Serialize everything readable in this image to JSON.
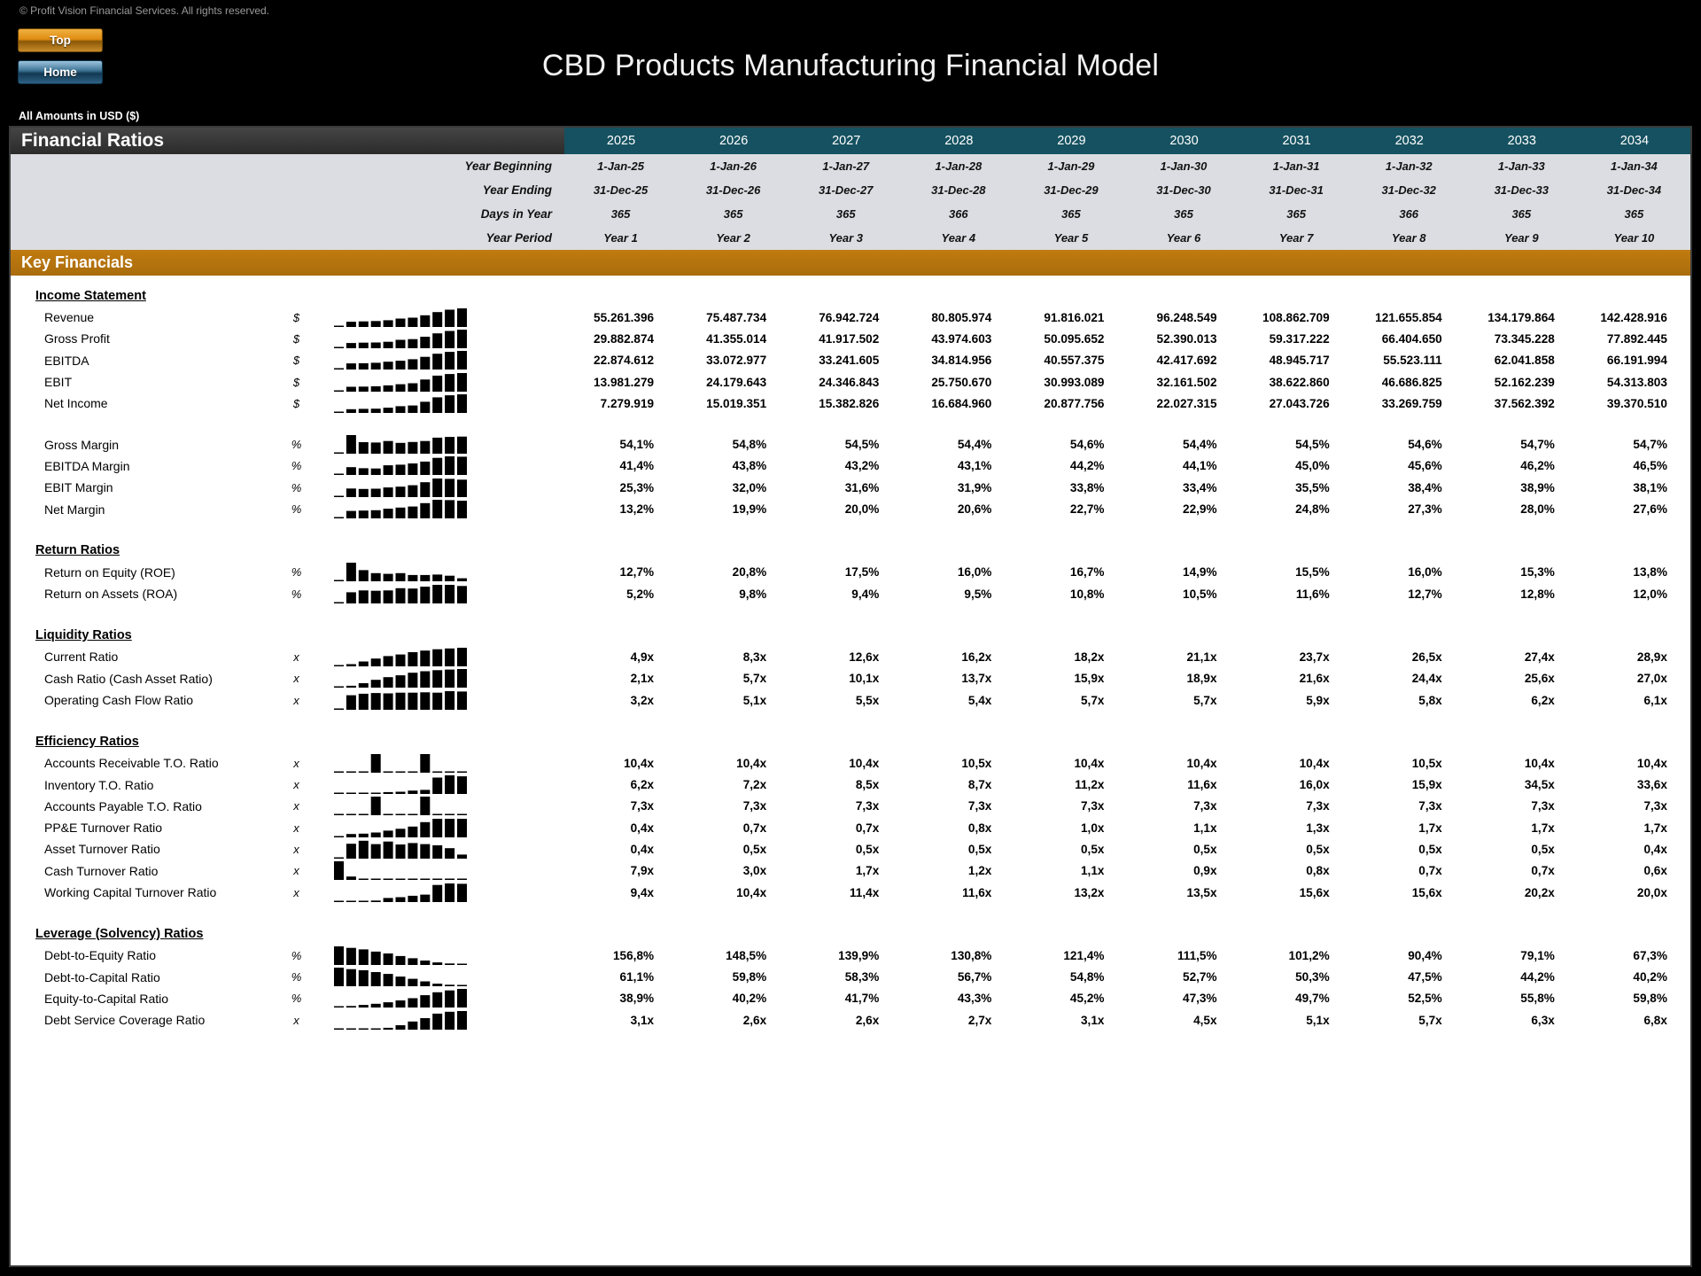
{
  "copyright": "© Profit Vision Financial Services. All rights reserved.",
  "nav": {
    "top_label": "Top",
    "home_label": "Home"
  },
  "title": "CBD Products Manufacturing Financial Model",
  "amounts_label": "All Amounts in  USD ($)",
  "section_title": "Financial Ratios",
  "key_financials_label": "Key Financials",
  "years": [
    "2025",
    "2026",
    "2027",
    "2028",
    "2029",
    "2030",
    "2031",
    "2032",
    "2033",
    "2034"
  ],
  "band": [
    {
      "label": "Year Beginning",
      "values": [
        "1-Jan-25",
        "1-Jan-26",
        "1-Jan-27",
        "1-Jan-28",
        "1-Jan-29",
        "1-Jan-30",
        "1-Jan-31",
        "1-Jan-32",
        "1-Jan-33",
        "1-Jan-34"
      ]
    },
    {
      "label": "Year Ending",
      "values": [
        "31-Dec-25",
        "31-Dec-26",
        "31-Dec-27",
        "31-Dec-28",
        "31-Dec-29",
        "31-Dec-30",
        "31-Dec-31",
        "31-Dec-32",
        "31-Dec-33",
        "31-Dec-34"
      ]
    },
    {
      "label": "Days in Year",
      "values": [
        "365",
        "365",
        "365",
        "366",
        "365",
        "365",
        "365",
        "366",
        "365",
        "365"
      ]
    },
    {
      "label": "Year Period",
      "values": [
        "Year 1",
        "Year 2",
        "Year 3",
        "Year 4",
        "Year 5",
        "Year 6",
        "Year 7",
        "Year 8",
        "Year 9",
        "Year 10"
      ]
    }
  ],
  "groups": [
    {
      "name": "Income Statement",
      "rows": [
        {
          "label": "Revenue",
          "unit": "$",
          "values": [
            "55.261.396",
            "75.487.734",
            "76.942.724",
            "80.805.974",
            "91.816.021",
            "96.248.549",
            "108.862.709",
            "121.655.854",
            "134.179.864",
            "142.428.916"
          ],
          "spark": [
            0.02,
            0.28,
            0.3,
            0.32,
            0.36,
            0.45,
            0.5,
            0.63,
            0.8,
            0.93,
            1.0
          ]
        },
        {
          "label": "Gross Profit",
          "unit": "$",
          "values": [
            "29.882.874",
            "41.355.014",
            "41.917.502",
            "43.974.603",
            "50.095.652",
            "52.390.013",
            "59.317.222",
            "66.404.650",
            "73.345.228",
            "77.892.445"
          ],
          "spark": [
            0.02,
            0.28,
            0.3,
            0.31,
            0.35,
            0.45,
            0.49,
            0.62,
            0.8,
            0.93,
            1.0
          ]
        },
        {
          "label": "EBITDA",
          "unit": "$",
          "values": [
            "22.874.612",
            "33.072.977",
            "33.241.605",
            "34.814.956",
            "40.557.375",
            "42.417.692",
            "48.945.717",
            "55.523.111",
            "62.041.858",
            "66.191.994"
          ],
          "spark": [
            0.02,
            0.33,
            0.34,
            0.36,
            0.42,
            0.47,
            0.55,
            0.68,
            0.85,
            0.95,
            1.0
          ]
        },
        {
          "label": "EBIT",
          "unit": "$",
          "values": [
            "13.981.279",
            "24.179.643",
            "24.346.843",
            "25.750.670",
            "30.993.089",
            "32.161.502",
            "38.622.860",
            "46.686.825",
            "52.162.239",
            "54.313.803"
          ],
          "spark": [
            0.02,
            0.26,
            0.27,
            0.29,
            0.34,
            0.4,
            0.45,
            0.65,
            0.86,
            0.95,
            1.0
          ]
        },
        {
          "label": "Net Income",
          "unit": "$",
          "values": [
            "7.279.919",
            "15.019.351",
            "15.382.826",
            "16.684.960",
            "20.877.756",
            "22.027.315",
            "27.043.726",
            "33.269.759",
            "37.562.392",
            "39.370.510"
          ],
          "spark": [
            0.02,
            0.2,
            0.22,
            0.23,
            0.28,
            0.36,
            0.4,
            0.6,
            0.84,
            0.95,
            1.0
          ]
        }
      ]
    },
    {
      "name": "",
      "rows": [
        {
          "label": "Gross Margin",
          "unit": "%",
          "values": [
            "54,1%",
            "54,8%",
            "54,5%",
            "54,4%",
            "54,6%",
            "54,4%",
            "54,5%",
            "54,6%",
            "54,7%",
            "54,7%"
          ],
          "spark": [
            0.05,
            1.0,
            0.62,
            0.6,
            0.68,
            0.58,
            0.63,
            0.68,
            0.86,
            0.9,
            0.92
          ]
        },
        {
          "label": "EBITDA Margin",
          "unit": "%",
          "values": [
            "41,4%",
            "43,8%",
            "43,2%",
            "43,1%",
            "44,2%",
            "44,1%",
            "45,0%",
            "45,6%",
            "46,2%",
            "46,5%"
          ],
          "spark": [
            0.05,
            0.42,
            0.36,
            0.35,
            0.52,
            0.55,
            0.62,
            0.72,
            0.92,
            1.0,
            0.98
          ]
        },
        {
          "label": "EBIT Margin",
          "unit": "%",
          "values": [
            "25,3%",
            "32,0%",
            "31,6%",
            "31,9%",
            "33,8%",
            "33,4%",
            "35,5%",
            "38,4%",
            "38,9%",
            "38,1%"
          ],
          "spark": [
            0.05,
            0.46,
            0.44,
            0.45,
            0.52,
            0.56,
            0.64,
            0.8,
            1.0,
            0.98,
            0.94
          ]
        },
        {
          "label": "Net Margin",
          "unit": "%",
          "values": [
            "13,2%",
            "19,9%",
            "20,0%",
            "20,6%",
            "22,7%",
            "22,9%",
            "24,8%",
            "27,3%",
            "28,0%",
            "27,6%"
          ],
          "spark": [
            0.05,
            0.4,
            0.42,
            0.44,
            0.52,
            0.58,
            0.64,
            0.82,
            1.0,
            0.98,
            0.95
          ]
        }
      ]
    },
    {
      "name": "Return Ratios",
      "rows": [
        {
          "label": "Return on Equity (ROE)",
          "unit": "%",
          "values": [
            "12,7%",
            "20,8%",
            "17,5%",
            "16,0%",
            "16,7%",
            "14,9%",
            "15,5%",
            "16,0%",
            "15,3%",
            "13,8%"
          ],
          "spark": [
            0.05,
            1.0,
            0.6,
            0.44,
            0.4,
            0.44,
            0.34,
            0.34,
            0.36,
            0.3,
            0.16
          ]
        },
        {
          "label": "Return on Assets (ROA)",
          "unit": "%",
          "values": [
            "5,2%",
            "9,8%",
            "9,4%",
            "9,5%",
            "10,8%",
            "10,5%",
            "11,6%",
            "12,7%",
            "12,8%",
            "12,0%"
          ],
          "spark": [
            0.05,
            0.6,
            0.7,
            0.68,
            0.7,
            0.82,
            0.8,
            0.9,
            1.0,
            1.0,
            0.94
          ]
        }
      ]
    },
    {
      "name": "Liquidity Ratios",
      "rows": [
        {
          "label": "Current Ratio",
          "unit": "x",
          "values": [
            "4,9x",
            "8,3x",
            "12,6x",
            "16,2x",
            "18,2x",
            "21,1x",
            "23,7x",
            "26,5x",
            "27,4x",
            "28,9x"
          ],
          "spark": [
            0.04,
            0.12,
            0.26,
            0.42,
            0.55,
            0.64,
            0.76,
            0.85,
            0.92,
            0.96,
            1.0
          ]
        },
        {
          "label": "Cash Ratio (Cash Asset Ratio)",
          "unit": "x",
          "values": [
            "2,1x",
            "5,7x",
            "10,1x",
            "13,7x",
            "15,9x",
            "18,9x",
            "21,6x",
            "24,4x",
            "25,6x",
            "27,0x"
          ],
          "spark": [
            0.04,
            0.1,
            0.24,
            0.42,
            0.56,
            0.66,
            0.8,
            0.88,
            0.94,
            0.97,
            1.0
          ]
        },
        {
          "label": "Operating Cash Flow Ratio",
          "unit": "x",
          "values": [
            "3,2x",
            "5,1x",
            "5,5x",
            "5,4x",
            "5,7x",
            "5,7x",
            "5,9x",
            "5,8x",
            "6,2x",
            "6,1x"
          ],
          "spark": [
            0.04,
            0.78,
            0.86,
            0.9,
            0.88,
            0.92,
            0.92,
            0.94,
            0.92,
            1.0,
            0.98
          ]
        }
      ]
    },
    {
      "name": "Efficiency Ratios",
      "rows": [
        {
          "label": "Accounts Receivable T.O. Ratio",
          "unit": "x",
          "values": [
            "10,4x",
            "10,4x",
            "10,4x",
            "10,5x",
            "10,4x",
            "10,4x",
            "10,4x",
            "10,5x",
            "10,4x",
            "10,4x"
          ],
          "spark": [
            0.03,
            0.03,
            0.03,
            1.0,
            0.03,
            0.03,
            0.03,
            1.0,
            0.03,
            0.03,
            0.03
          ]
        },
        {
          "label": "Inventory T.O. Ratio",
          "unit": "x",
          "values": [
            "6,2x",
            "7,2x",
            "8,5x",
            "8,7x",
            "11,2x",
            "11,6x",
            "16,0x",
            "15,9x",
            "34,5x",
            "33,6x"
          ],
          "spark": [
            0.03,
            0.04,
            0.05,
            0.06,
            0.1,
            0.12,
            0.18,
            0.22,
            0.88,
            1.0,
            0.95
          ]
        },
        {
          "label": "Accounts Payable T.O. Ratio",
          "unit": "x",
          "values": [
            "7,3x",
            "7,3x",
            "7,3x",
            "7,3x",
            "7,3x",
            "7,3x",
            "7,3x",
            "7,3x",
            "7,3x",
            "7,3x"
          ],
          "spark": [
            0.03,
            0.03,
            0.03,
            1.0,
            0.03,
            0.03,
            0.03,
            1.0,
            0.03,
            0.03,
            0.03
          ]
        },
        {
          "label": "PP&E Turnover Ratio",
          "unit": "x",
          "values": [
            "0,4x",
            "0,7x",
            "0,7x",
            "0,8x",
            "1,0x",
            "1,1x",
            "1,3x",
            "1,7x",
            "1,7x",
            "1,7x"
          ],
          "spark": [
            0.04,
            0.18,
            0.2,
            0.26,
            0.36,
            0.46,
            0.58,
            0.82,
            1.0,
            1.0,
            1.0
          ]
        },
        {
          "label": "Asset Turnover Ratio",
          "unit": "x",
          "values": [
            "0,4x",
            "0,5x",
            "0,5x",
            "0,5x",
            "0,5x",
            "0,5x",
            "0,5x",
            "0,5x",
            "0,5x",
            "0,4x"
          ],
          "spark": [
            0.04,
            0.8,
            0.96,
            0.78,
            0.92,
            0.76,
            0.84,
            0.78,
            0.72,
            0.56,
            0.22
          ]
        },
        {
          "label": "Cash Turnover Ratio",
          "unit": "x",
          "values": [
            "7,9x",
            "3,0x",
            "1,7x",
            "1,2x",
            "1,1x",
            "0,9x",
            "0,8x",
            "0,7x",
            "0,7x",
            "0,6x"
          ],
          "spark": [
            1.0,
            0.18,
            0.06,
            0.04,
            0.04,
            0.03,
            0.03,
            0.03,
            0.03,
            0.03,
            0.03
          ]
        },
        {
          "label": "Working Capital Turnover Ratio",
          "unit": "x",
          "values": [
            "9,4x",
            "10,4x",
            "11,4x",
            "11,6x",
            "13,2x",
            "13,5x",
            "15,6x",
            "15,6x",
            "20,2x",
            "20,0x"
          ],
          "spark": [
            0.03,
            0.04,
            0.05,
            0.08,
            0.22,
            0.26,
            0.34,
            0.4,
            0.92,
            1.0,
            0.98
          ]
        }
      ]
    },
    {
      "name": "Leverage (Solvency) Ratios",
      "rows": [
        {
          "label": "Debt-to-Equity Ratio",
          "unit": "%",
          "values": [
            "156,8%",
            "148,5%",
            "139,9%",
            "130,8%",
            "121,4%",
            "111,5%",
            "101,2%",
            "90,4%",
            "79,1%",
            "67,3%"
          ],
          "spark": [
            1.0,
            0.92,
            0.84,
            0.72,
            0.62,
            0.48,
            0.36,
            0.24,
            0.14,
            0.08,
            0.04
          ]
        },
        {
          "label": "Debt-to-Capital Ratio",
          "unit": "%",
          "values": [
            "61,1%",
            "59,8%",
            "58,3%",
            "56,7%",
            "54,8%",
            "52,7%",
            "50,3%",
            "47,5%",
            "44,2%",
            "40,2%"
          ],
          "spark": [
            1.0,
            0.92,
            0.86,
            0.76,
            0.66,
            0.52,
            0.4,
            0.26,
            0.14,
            0.08,
            0.04
          ]
        },
        {
          "label": "Equity-to-Capital Ratio",
          "unit": "%",
          "values": [
            "38,9%",
            "40,2%",
            "41,7%",
            "43,3%",
            "45,2%",
            "47,3%",
            "49,7%",
            "52,5%",
            "55,8%",
            "59,8%"
          ],
          "spark": [
            0.04,
            0.08,
            0.14,
            0.2,
            0.28,
            0.38,
            0.5,
            0.66,
            0.82,
            0.92,
            1.0
          ]
        },
        {
          "label": "Debt Service Coverage Ratio",
          "unit": "x",
          "values": [
            "3,1x",
            "2,6x",
            "2,6x",
            "2,7x",
            "3,1x",
            "4,5x",
            "5,1x",
            "5,7x",
            "6,3x",
            "6,8x"
          ],
          "spark": [
            0.03,
            0.04,
            0.05,
            0.06,
            0.1,
            0.24,
            0.44,
            0.62,
            0.86,
            0.96,
            1.0
          ]
        }
      ]
    }
  ]
}
